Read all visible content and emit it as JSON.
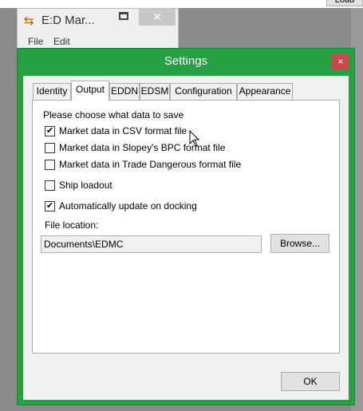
{
  "background_window": {
    "title": "E:D Mar...",
    "menu": [
      "File",
      "Edit"
    ],
    "top_button": "Load"
  },
  "dialog": {
    "title": "Settings",
    "close_glyph": "×",
    "tabs": [
      {
        "label": "Identity",
        "active": false
      },
      {
        "label": "Output",
        "active": true
      },
      {
        "label": "EDDN",
        "active": false
      },
      {
        "label": "EDSM",
        "active": false
      },
      {
        "label": "Configuration",
        "active": false
      },
      {
        "label": "Appearance",
        "active": false
      }
    ],
    "prompt": "Please choose what data to save",
    "options": [
      {
        "label": "Market data in CSV format file",
        "checked": true
      },
      {
        "label": "Market data in Slopey's BPC format file",
        "checked": false
      },
      {
        "label": "Market data in Trade Dangerous format file",
        "checked": false
      },
      {
        "label": "Ship loadout",
        "checked": false
      },
      {
        "label": "Automatically update on docking",
        "checked": true
      }
    ],
    "file_location_label": "File location:",
    "file_location_value": "Documents\\EDMC",
    "browse_label": "Browse...",
    "ok_label": "OK"
  },
  "colors": {
    "dialog_border": "#26a043",
    "close_button": "#c84b4b"
  }
}
